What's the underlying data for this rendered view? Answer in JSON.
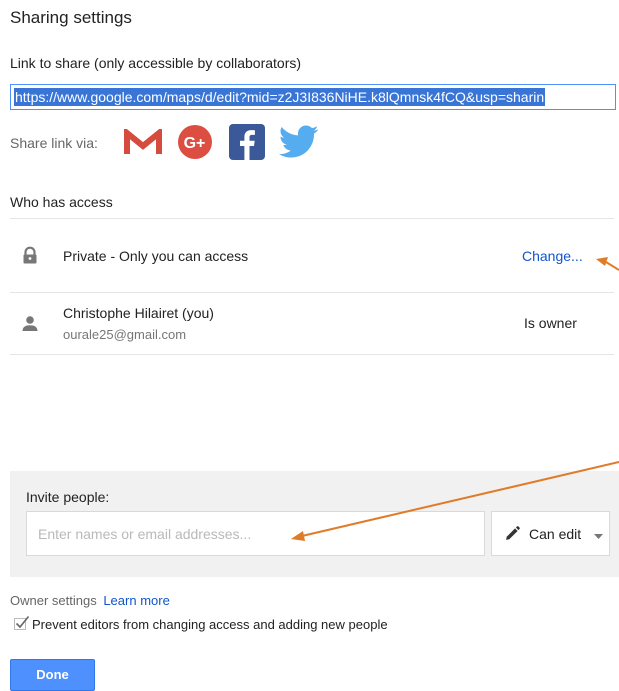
{
  "dialog": {
    "title": "Sharing settings"
  },
  "link": {
    "label": "Link to share (only accessible by collaborators)",
    "url": "https://www.google.com/maps/d/edit?mid=z2J3I836NiHE.k8lQmnsk4fCQ&usp=sharin"
  },
  "share_via": {
    "label": "Share link via:",
    "icons": [
      "gmail-icon",
      "google-plus-icon",
      "facebook-icon",
      "twitter-icon"
    ]
  },
  "access": {
    "heading": "Who has access",
    "rows": [
      {
        "icon": "lock-icon",
        "text": "Private - Only you can access",
        "action": "Change..."
      },
      {
        "icon": "person-icon",
        "name": "Christophe Hilairet (you)",
        "email": "ourale25@gmail.com",
        "role": "Is owner"
      }
    ]
  },
  "invite": {
    "label": "Invite people:",
    "placeholder": "Enter names or email addresses...",
    "permission": "Can edit"
  },
  "owner_settings": {
    "label": "Owner settings",
    "learn_more": "Learn more",
    "prevent_label": "Prevent editors from changing access and adding new people",
    "prevent_checked": true
  },
  "actions": {
    "done": "Done"
  },
  "colors": {
    "link": "#1155cc",
    "accent": "#4d90fe",
    "annotation_arrow": "#e07b28"
  }
}
